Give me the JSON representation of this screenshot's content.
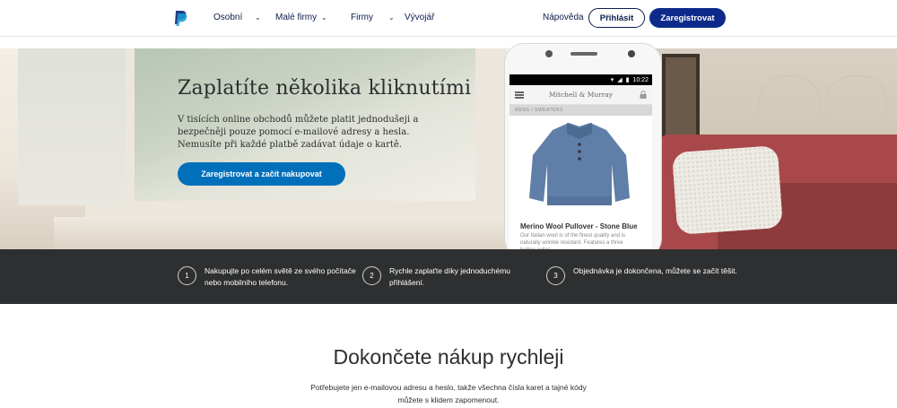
{
  "nav": {
    "items": [
      {
        "label": "Osobní",
        "has_dropdown": true
      },
      {
        "label": "Malé firmy",
        "has_dropdown": true
      },
      {
        "label": "Firmy",
        "has_dropdown": true
      },
      {
        "label": "Vývojář",
        "has_dropdown": false
      }
    ],
    "help": "Nápověda",
    "login": "Přihlásit",
    "signup": "Zaregistrovat",
    "brand_color": "#0d2a8a"
  },
  "hero": {
    "title": "Zaplatíte několika kliknutími",
    "description": "V tisících online obchodů můžete platit jednodušeji a bezpečněji pouze pomocí e-mailové adresy a hesla. Nemusíte při každé platbě zadávat údaje o kartě.",
    "cta": "Zaregistrovat a začít nakupovat",
    "cta_color": "#0070ba"
  },
  "phone": {
    "time": "10:22",
    "store_name": "Mitchell & Murray",
    "breadcrumb": "MENS   /   SWEATERS",
    "product_name": "Merino Wool Pullover - Stone Blue",
    "product_desc": "Our Italian wool is of the finest quality and is naturally wrinkle resistant. Features a three button collar."
  },
  "steps": [
    {
      "num": "1",
      "text": "Nakupujte po celém světě ze svého počítače nebo mobilního telefonu."
    },
    {
      "num": "2",
      "text": "Rychle zaplaťte díky jednoduchému přihlášení."
    },
    {
      "num": "3",
      "text": "Objednávka je dokončena, můžete se začít těšit."
    }
  ],
  "section": {
    "title": "Dokončete nákup rychleji",
    "description": "Potřebujete jen e-mailovou adresu a heslo, takže všechna čísla karet a tajné kódy můžete s klidem zapomenout."
  }
}
